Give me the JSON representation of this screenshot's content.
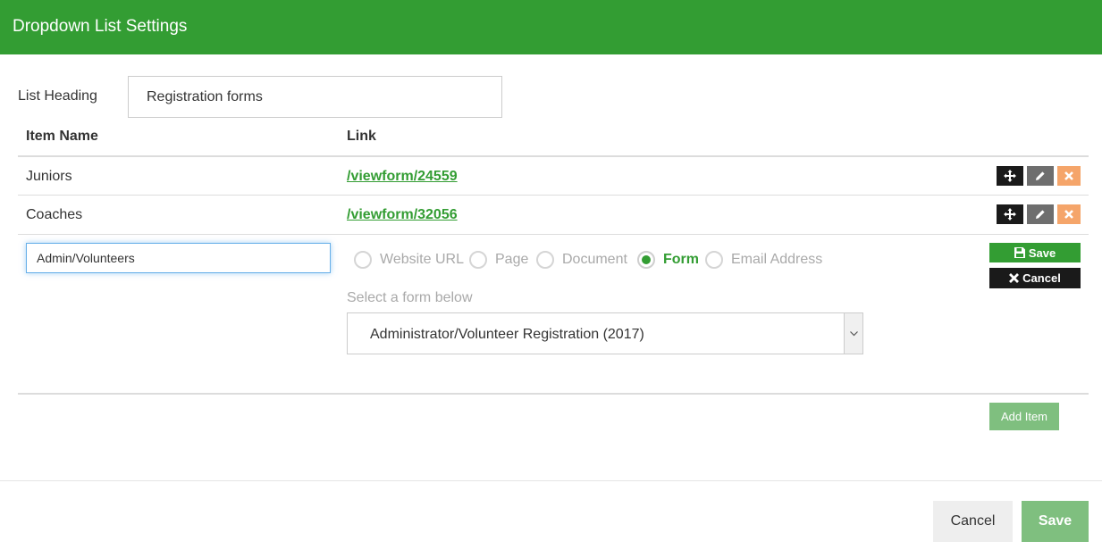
{
  "dialog": {
    "title": "Dropdown List Settings"
  },
  "list_heading": {
    "label": "List Heading",
    "value": "Registration forms"
  },
  "columns": {
    "item_name": "Item Name",
    "link": "Link"
  },
  "rows": [
    {
      "name": "Juniors",
      "link": "/viewform/24559"
    },
    {
      "name": "Coaches",
      "link": "/viewform/32056"
    }
  ],
  "editing_row": {
    "name_value": "Admin/Volunteers",
    "link_types": [
      {
        "label": "Website URL",
        "checked": false
      },
      {
        "label": "Page",
        "checked": false
      },
      {
        "label": "Document",
        "checked": false
      },
      {
        "label": "Form",
        "checked": true
      },
      {
        "label": "Email Address",
        "checked": false
      }
    ],
    "select_label": "Select a form below",
    "selected_form": "Administrator/Volunteer Registration (2017)",
    "save_label": "Save",
    "cancel_label": "Cancel"
  },
  "add_item_label": "Add Item",
  "footer": {
    "cancel_label": "Cancel",
    "save_label": "Save"
  },
  "colors": {
    "brand_green": "#339d33",
    "light_green": "#7fbf7f",
    "delete_orange": "#f5a56a",
    "dark": "#1a1a1a"
  },
  "icons": [
    "move-icon",
    "pencil-icon",
    "close-icon",
    "floppy-disk-icon",
    "chevron-down-icon"
  ]
}
